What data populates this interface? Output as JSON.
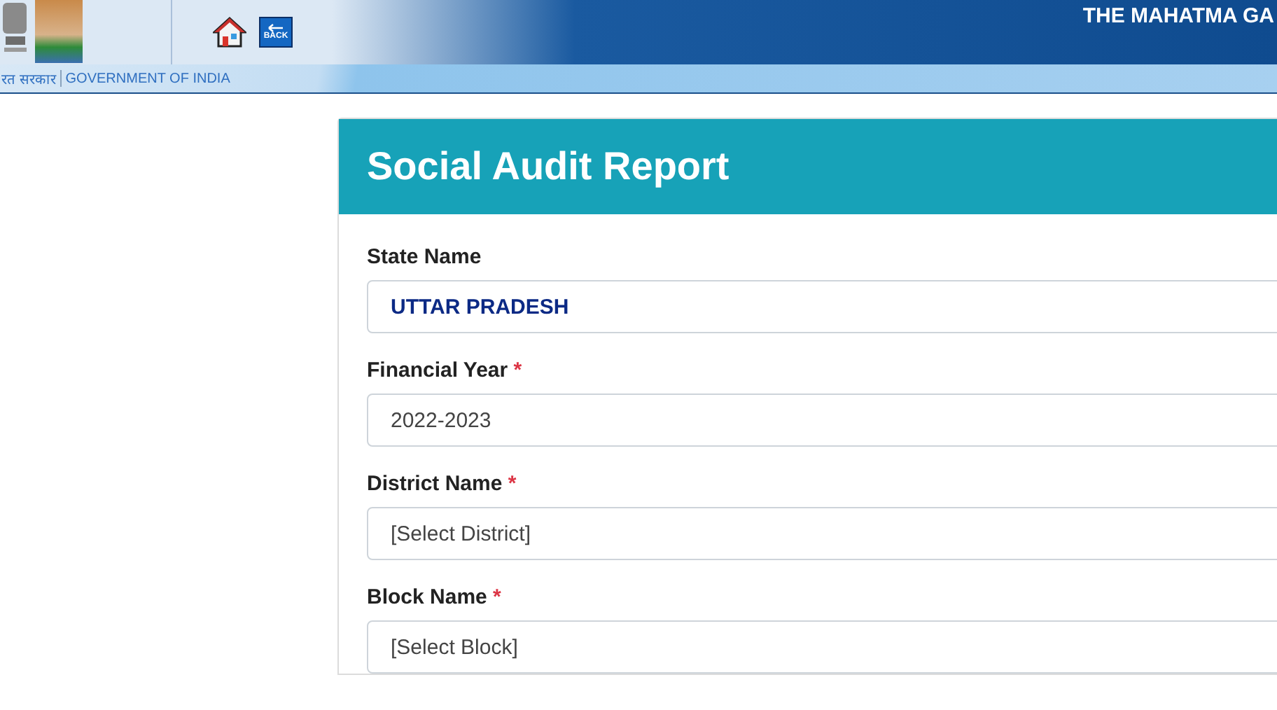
{
  "header": {
    "title": "THE MAHATMA GA",
    "back_label": "BACK",
    "gov_hindi": "रत सरकार",
    "gov_english": "GOVERNMENT OF INDIA"
  },
  "form": {
    "title": "Social Audit Report",
    "required_symbol": "*",
    "fields": [
      {
        "label": "State Name",
        "required": false,
        "kind": "static",
        "value": "UTTAR PRADESH"
      },
      {
        "label": "Financial Year",
        "required": true,
        "kind": "select",
        "value": "2022-2023"
      },
      {
        "label": "District Name",
        "required": true,
        "kind": "select",
        "value": "[Select District]"
      },
      {
        "label": "Block Name",
        "required": true,
        "kind": "select",
        "value": "[Select Block]"
      }
    ]
  }
}
